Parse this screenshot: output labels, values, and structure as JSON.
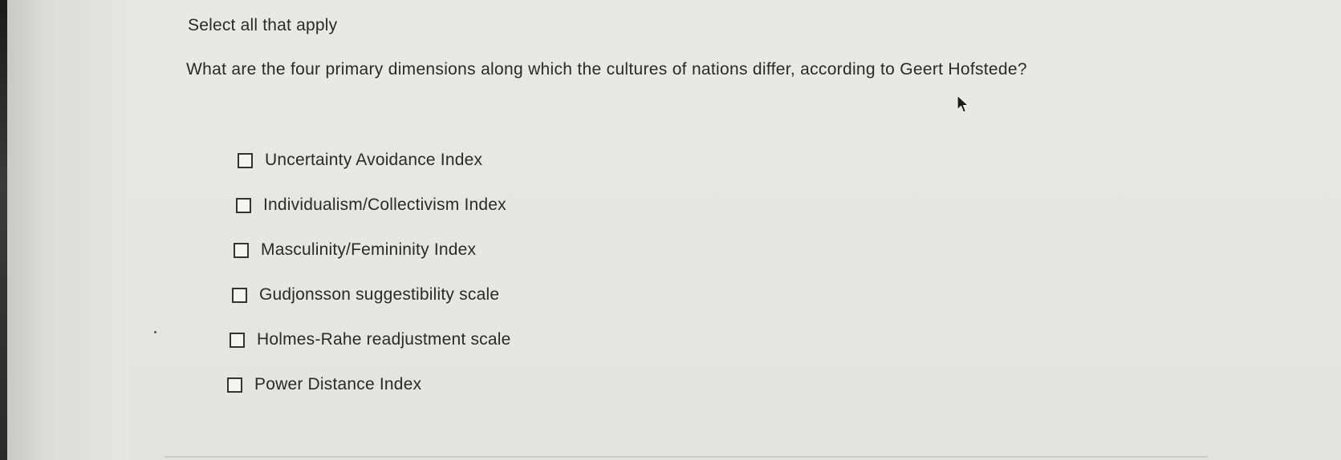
{
  "question": {
    "instruction": "Select all that apply",
    "prompt": "What are the four primary dimensions along which the cultures of nations differ, according to Geert Hofstede?"
  },
  "options": [
    {
      "label": "Uncertainty Avoidance Index",
      "checked": false
    },
    {
      "label": "Individualism/Collectivism Index",
      "checked": false
    },
    {
      "label": "Masculinity/Femininity Index",
      "checked": false
    },
    {
      "label": "Gudjonsson suggestibility scale",
      "checked": false
    },
    {
      "label": "Holmes-Rahe readjustment scale",
      "checked": false
    },
    {
      "label": "Power Distance Index",
      "checked": false
    }
  ],
  "colors": {
    "text": "#2a2a2a",
    "checkbox_border": "#333333",
    "background": "#e6e6e4"
  },
  "icons": {
    "cursor": "mouse-pointer-icon",
    "checkbox": "empty-checkbox-icon"
  }
}
